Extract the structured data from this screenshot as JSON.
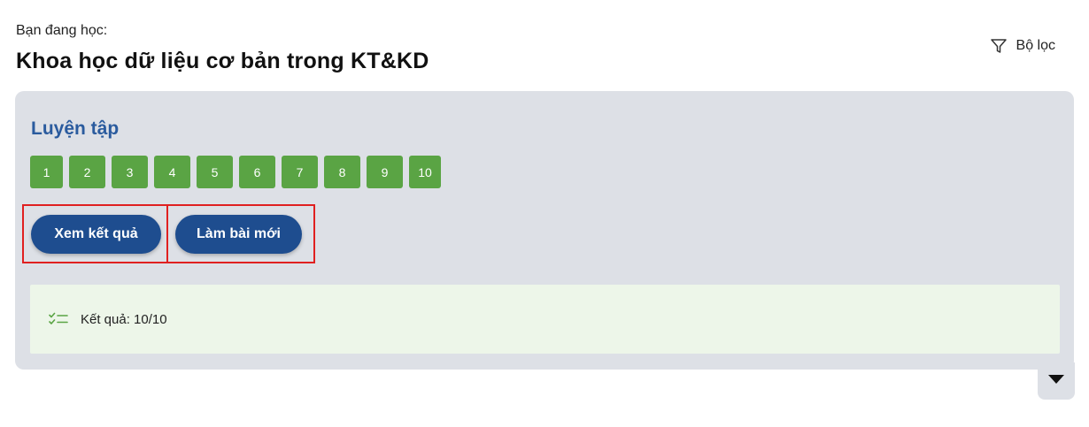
{
  "header": {
    "studying_label": "Bạn đang học:",
    "course_title": "Khoa học dữ liệu cơ bản trong KT&KD",
    "filter_label": "Bộ lọc"
  },
  "practice": {
    "title": "Luyện tập",
    "questions": [
      "1",
      "2",
      "3",
      "4",
      "5",
      "6",
      "7",
      "8",
      "9",
      "10"
    ],
    "buttons": {
      "view_results": "Xem kết quả",
      "new_attempt": "Làm bài mới"
    },
    "result_text": "Kết quả: 10/10"
  },
  "colors": {
    "accent": "#1e4d8f",
    "title_blue": "#2a5b9e",
    "question_green": "#5aa444",
    "panel_bg": "#dde0e6",
    "result_bg": "#edf6e9",
    "highlight_red": "#e02020"
  },
  "icons": {
    "filter": "filter-icon",
    "checklist": "checklist-icon",
    "expand": "caret-down-icon"
  }
}
